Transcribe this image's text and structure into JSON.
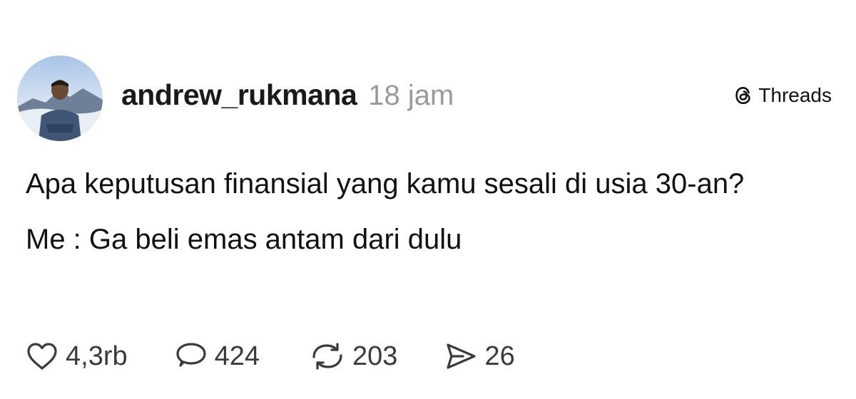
{
  "post": {
    "username": "andrew_rukmana",
    "timestamp": "18 jam",
    "brand_label": "Threads",
    "paragraphs": [
      "Apa keputusan finansial yang kamu sesali di usia 30-an?",
      "Me : Ga beli emas antam dari dulu"
    ],
    "stats": {
      "likes": "4,3rb",
      "replies": "424",
      "reposts": "203",
      "shares": "26"
    }
  },
  "icons": {
    "brand": "threads-logo-icon",
    "like": "heart-icon",
    "reply": "speech-bubble-icon",
    "repost": "repost-arrows-icon",
    "share": "send-arrow-icon"
  },
  "colors": {
    "background": "#ffffff",
    "text": "#111111",
    "muted": "#9a9a9a",
    "icon": "#3a3a3a"
  }
}
